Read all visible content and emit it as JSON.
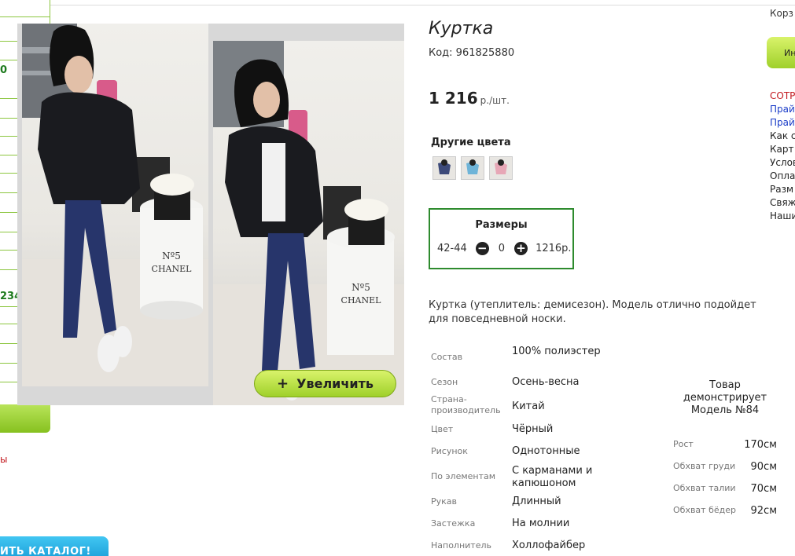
{
  "sidebar": {
    "fragments": [
      "0",
      "234"
    ],
    "red_text": "ы",
    "catalog_button": "ИТЬ КАТАЛОГ!"
  },
  "product": {
    "title": "Куртка",
    "code": "Код: 961825880",
    "price": "1 216",
    "price_unit": "р./шт.",
    "enlarge_label": "Увеличить",
    "other_colors_heading": "Другие цвета",
    "sizes": {
      "heading": "Размеры",
      "size": "42-44",
      "quantity": "0",
      "price": "1216р."
    },
    "description": "Куртка (утеплитель: демисезон). Модель отлично подойдет для повседневной носки.",
    "attributes": [
      {
        "key": "Состав",
        "value": "100% полиэстер"
      },
      {
        "key": "Сезон",
        "value": "Осень-весна"
      },
      {
        "key": "Страна-производитель",
        "value": "Китай"
      },
      {
        "key": "Цвет",
        "value": "Чёрный"
      },
      {
        "key": "Рисунок",
        "value": "Однотонные"
      },
      {
        "key": "По элементам",
        "value": "С карманами и капюшоном"
      },
      {
        "key": "Рукав",
        "value": "Длинный"
      },
      {
        "key": "Застежка",
        "value": "На молнии"
      },
      {
        "key": "Наполнитель",
        "value": "Холлофайбер"
      }
    ],
    "model": {
      "heading": "Товар демонстрирует Модель №84",
      "measurements": [
        {
          "key": "Рост",
          "value": "170см"
        },
        {
          "key": "Обхват груди",
          "value": "90см"
        },
        {
          "key": "Обхват талии",
          "value": "70см"
        },
        {
          "key": "Обхват бёдер",
          "value": "92см"
        }
      ]
    }
  },
  "right_column": {
    "cart": "Корз",
    "button": "Ин",
    "links": [
      "СОТР",
      "Прай",
      "Прай",
      "Как с",
      "Карт",
      "Услов",
      "Опла",
      "Разм",
      "Свяж",
      "Наши"
    ]
  },
  "colors": {
    "accent_green": "#8cc63f",
    "size_border": "#2e8b2e",
    "red": "#c2181e",
    "blue": "#1a3cc8"
  }
}
